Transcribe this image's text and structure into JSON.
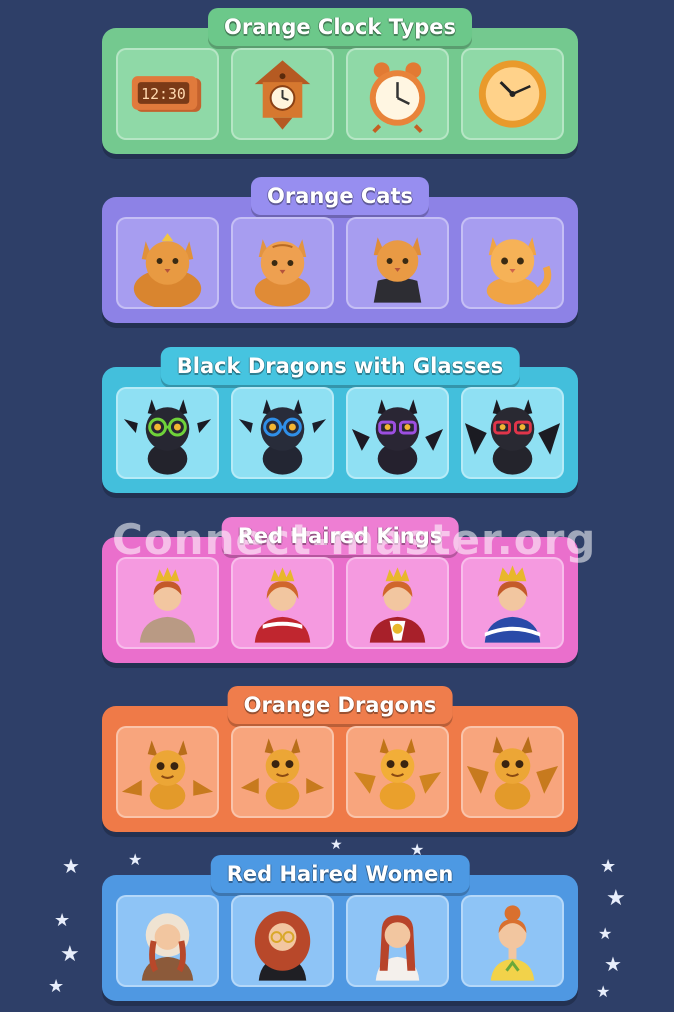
{
  "groups": [
    {
      "id": "clock",
      "title": "Orange Clock Types",
      "items": [
        "digital-clock-icon",
        "cuckoo-clock-icon",
        "alarm-clock-icon",
        "wall-clock-icon"
      ],
      "digital_time": "12:30"
    },
    {
      "id": "cat",
      "title": "Orange Cats",
      "items": [
        "fluffy-cat-icon",
        "tabby-cat-icon",
        "cat-in-vest-icon",
        "ginger-cat-icon"
      ]
    },
    {
      "id": "bdragon",
      "title": "Black Dragons with Glasses",
      "items": [
        "dragon-green-glasses-icon",
        "dragon-blue-glasses-icon",
        "dragon-purple-glasses-icon",
        "dragon-red-glasses-icon"
      ]
    },
    {
      "id": "king",
      "title": "Red Haired Kings",
      "items": [
        "king-1-icon",
        "king-2-icon",
        "king-3-icon",
        "king-4-icon"
      ]
    },
    {
      "id": "odragon",
      "title": "Orange Dragons",
      "items": [
        "orange-dragon-1-icon",
        "orange-dragon-2-icon",
        "orange-dragon-3-icon",
        "orange-dragon-4-icon"
      ]
    },
    {
      "id": "women",
      "title": "Red Haired Women",
      "items": [
        "woman-bonnet-icon",
        "woman-glasses-icon",
        "woman-braids-icon",
        "woman-updo-icon"
      ]
    }
  ],
  "watermark": "Connect-master.org",
  "colors": {
    "background": "#2e3f68",
    "clock": "#74c98f",
    "cat": "#8d82e6",
    "bdragon": "#43bfdc",
    "king": "#ea6fcc",
    "odragon": "#ef7a48",
    "women": "#4f98e2"
  }
}
